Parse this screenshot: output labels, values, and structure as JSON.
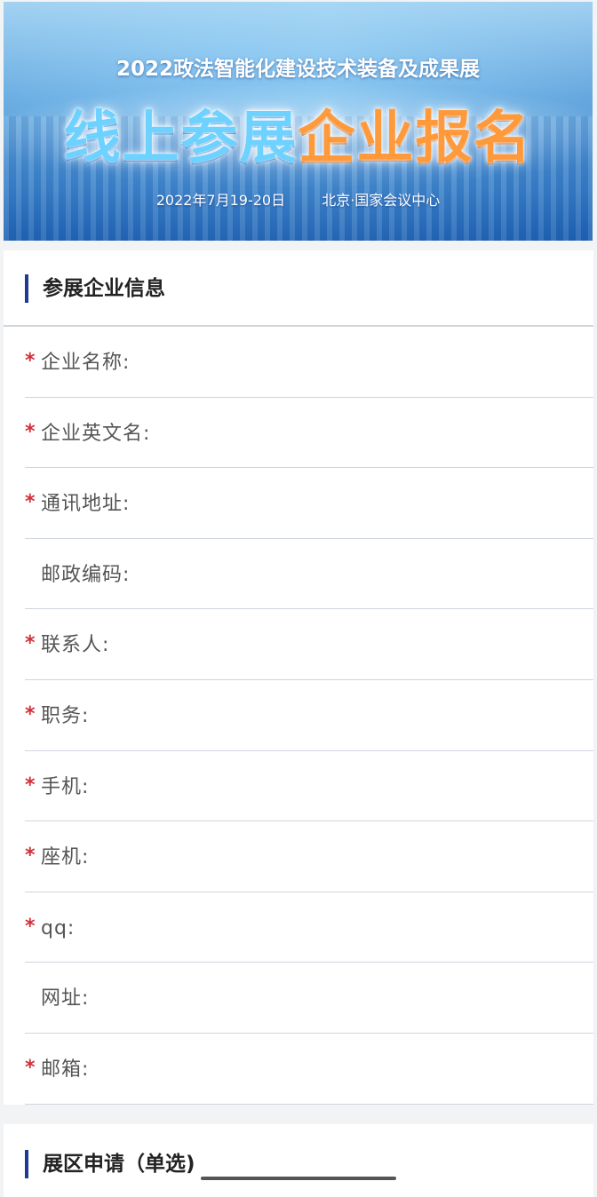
{
  "banner": {
    "title": "2022政法智能化建设技术装备及成果展",
    "main_part_a": "线上参展",
    "main_part_b": "企业报名",
    "date": "2022年7月19-20日",
    "venue": "北京·国家会议中心"
  },
  "section1": {
    "title": "参展企业信息",
    "fields": [
      {
        "label": "企业名称:",
        "required": "*",
        "value": ""
      },
      {
        "label": "企业英文名:",
        "required": "*",
        "value": ""
      },
      {
        "label": "通讯地址:",
        "required": "*",
        "value": ""
      },
      {
        "label": "邮政编码:",
        "required": "",
        "value": ""
      },
      {
        "label": "联系人:",
        "required": "*",
        "value": ""
      },
      {
        "label": "职务:",
        "required": "*",
        "value": ""
      },
      {
        "label": "手机:",
        "required": "*",
        "value": ""
      },
      {
        "label": "座机:",
        "required": "*",
        "value": ""
      },
      {
        "label": "qq:",
        "required": "*",
        "value": ""
      },
      {
        "label": "网址:",
        "required": "",
        "value": ""
      },
      {
        "label": "邮箱:",
        "required": "*",
        "value": ""
      }
    ]
  },
  "section2": {
    "title": "展区申请（单选)"
  },
  "colors": {
    "accent_bar": "#1f3a93",
    "required_star": "#d0313a",
    "orange_title": "#ff9a3c",
    "blue_title": "#6dd2ff"
  }
}
